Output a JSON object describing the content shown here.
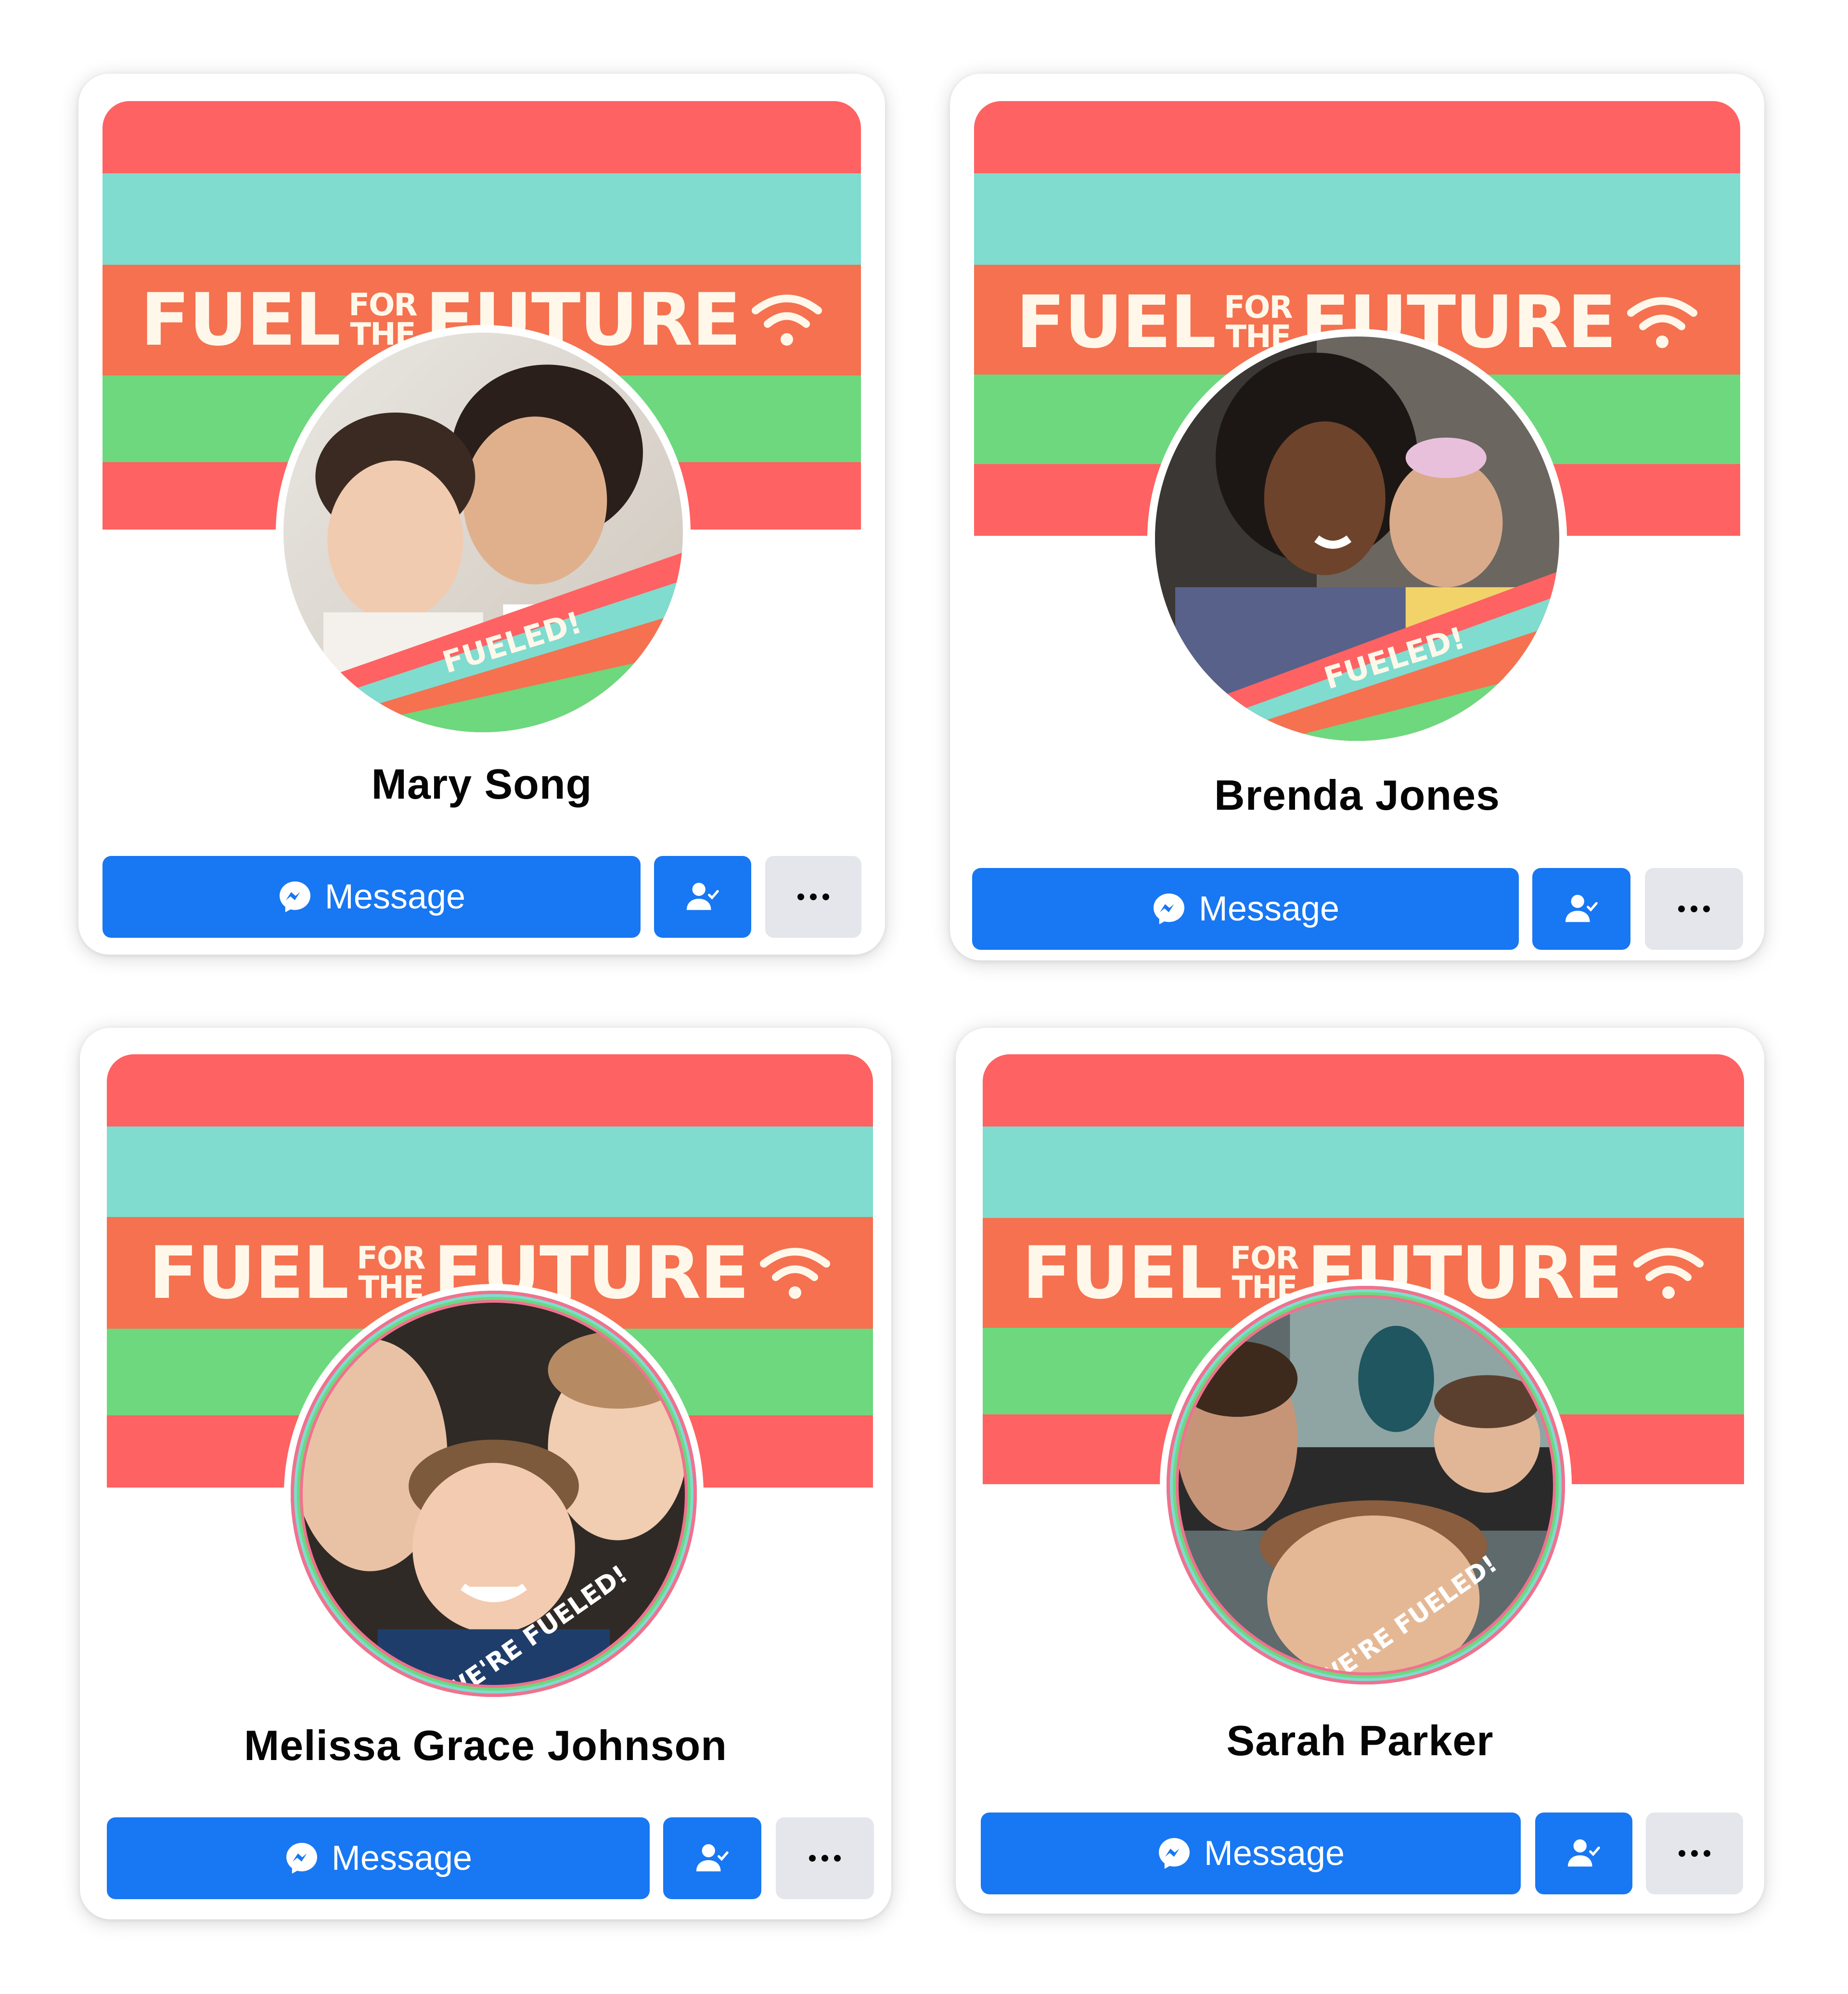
{
  "banner": {
    "line1": "FUEL",
    "line2a": "FOR",
    "line2b": "THE",
    "line3": "FUTURE"
  },
  "colors": {
    "red": "#ff6262",
    "teal": "#7fdccf",
    "orange": "#f57150",
    "green": "#6dd87e",
    "messenger_blue": "#1877f2",
    "grey_button": "#e4e6eb"
  },
  "profiles": [
    {
      "name": "Mary Song",
      "frame_text": "FUELED!",
      "message_label": "Message"
    },
    {
      "name": "Brenda Jones",
      "frame_text": "FUELED!",
      "message_label": "Message"
    },
    {
      "name": "Melissa Grace Johnson",
      "frame_text": "WE'RE FUELED!",
      "message_label": "Message"
    },
    {
      "name": "Sarah Parker",
      "frame_text": "WE'RE FUELED!",
      "message_label": "Message"
    }
  ],
  "icons": {
    "message": "messenger-icon",
    "friends": "friends-check-icon",
    "more": "more-dots-icon"
  }
}
